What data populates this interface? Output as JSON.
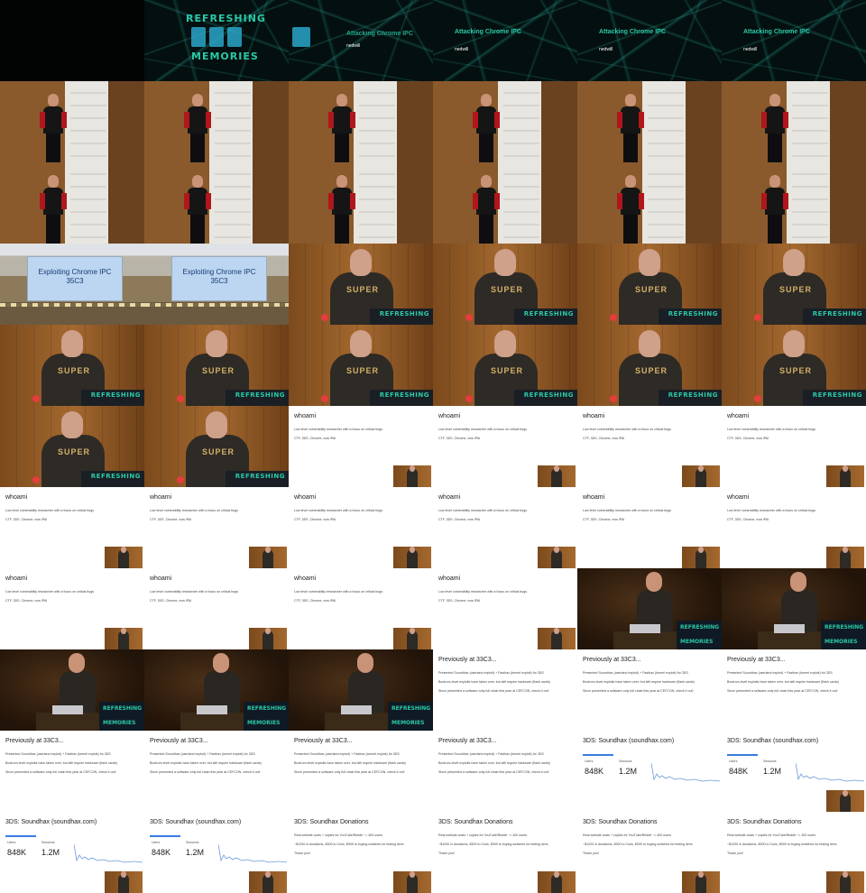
{
  "title_sequence": {
    "logo_top": "REFRESHING",
    "logo_bottom": "MEMORIES",
    "talk_title": "Attacking Chrome IPC",
    "speaker": "nedwill"
  },
  "hall_slide": {
    "line1": "Exploiting Chrome IPC",
    "line2": "35C3"
  },
  "podium_logo": "REFRESHING",
  "hoodie_text": "SUPER",
  "whoami": {
    "title": "whoami",
    "lines": [
      "Low level vulnerability researcher with a focus on critical bugs",
      "CTF, 3DS, Chrome, now iPAI"
    ]
  },
  "previously": {
    "title": "Previously at 33C3...",
    "lines": [
      "Presented Soundhax (userland exploit) + Fasthax (kernel exploit) for 3DS",
      "Bootrom-level exploits have taken over, but still require hardware (flash cards)",
      "Since presented a software-only full chain this year at CEFCON, check it out!"
    ]
  },
  "stats": {
    "title": "3DS: Soundhax (soundhax.com)",
    "users_label": "Users",
    "users_value": "848K",
    "sessions_label": "Sessions",
    "sessions_value": "1.2M"
  },
  "donations": {
    "title": "3DS: Soundhax Donations",
    "lines": [
      "Real website costs + copies for YouTube/Reddit ~= 400 users",
      "~$1200 in donations, $300 to Cons, $900 to buying switches for testing devs",
      "Thank you!"
    ]
  }
}
